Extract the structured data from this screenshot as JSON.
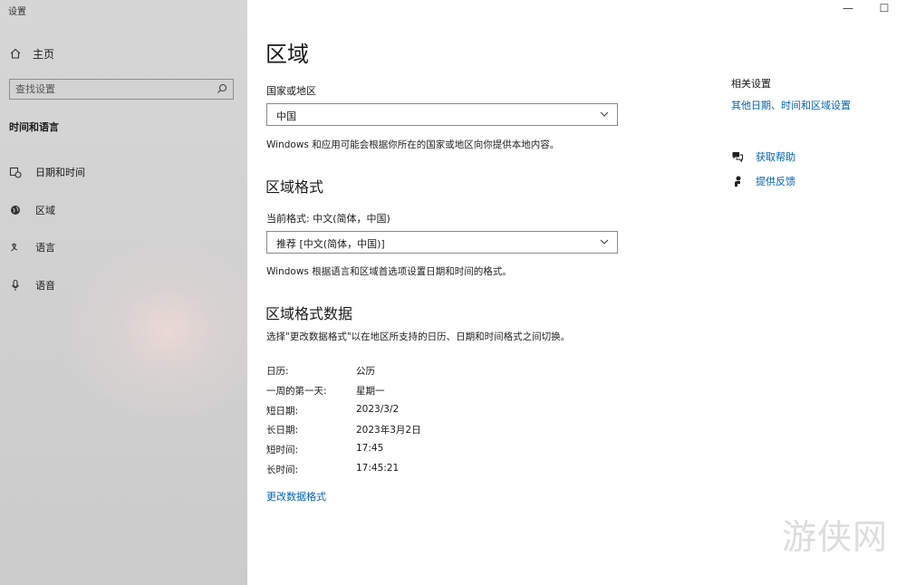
{
  "window": {
    "title": "设置",
    "minimize": "—",
    "maximize": "☐"
  },
  "sidebar": {
    "home": "主页",
    "search_placeholder": "查找设置",
    "section": "时间和语言",
    "items": [
      {
        "label": "日期和时间",
        "icon": "calendar-clock-icon"
      },
      {
        "label": "区域",
        "icon": "globe-icon"
      },
      {
        "label": "语言",
        "icon": "language-icon"
      },
      {
        "label": "语音",
        "icon": "microphone-icon"
      }
    ]
  },
  "main": {
    "title": "区域",
    "country_label": "国家或地区",
    "country_value": "中国",
    "country_desc": "Windows 和应用可能会根据你所在的国家或地区向你提供本地内容。",
    "format_heading": "区域格式",
    "current_format": "当前格式: 中文(简体，中国)",
    "format_value": "推荐 [中文(简体，中国)]",
    "format_desc": "Windows 根据语言和区域首选项设置日期和时间的格式。",
    "data_heading": "区域格式数据",
    "data_desc": "选择\"更改数据格式\"以在地区所支持的日历、日期和时间格式之间切换。",
    "rows": [
      {
        "key": "日历:",
        "value": "公历"
      },
      {
        "key": "一周的第一天:",
        "value": "星期一"
      },
      {
        "key": "短日期:",
        "value": "2023/3/2"
      },
      {
        "key": "长日期:",
        "value": "2023年3月2日"
      },
      {
        "key": "短时间:",
        "value": "17:45"
      },
      {
        "key": "长时间:",
        "value": "17:45:21"
      }
    ],
    "change_link": "更改数据格式"
  },
  "related": {
    "title": "相关设置",
    "link": "其他日期、时间和区域设置",
    "help": "获取帮助",
    "feedback": "提供反馈"
  },
  "watermark": "游侠网",
  "colors": {
    "accent": "#0063b1",
    "sidebar_bg": "#cfcfcf"
  }
}
